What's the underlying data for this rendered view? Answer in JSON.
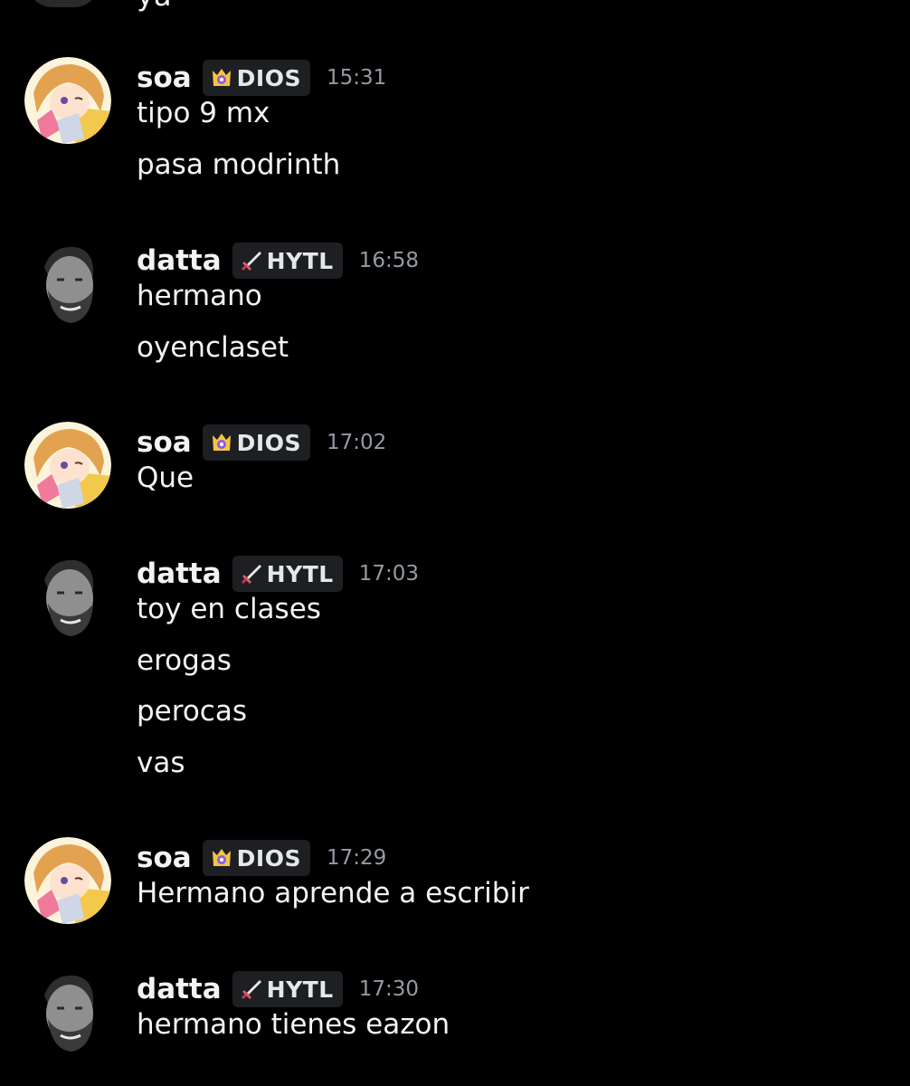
{
  "partial_message": {
    "text": "ya"
  },
  "messages": [
    {
      "author": "soa",
      "avatar": "anime-girl-avatar",
      "tag": {
        "icon": "crown-badge-icon",
        "label": "DIOS"
      },
      "time": "15:31",
      "lines": [
        "tipo 9 mx",
        "pasa modrinth"
      ]
    },
    {
      "author": "datta",
      "avatar": "bearded-man-avatar",
      "tag": {
        "icon": "sword-icon",
        "label": "HYTL"
      },
      "time": "16:58",
      "lines": [
        "hermano",
        "oyenclaset"
      ]
    },
    {
      "author": "soa",
      "avatar": "anime-girl-avatar",
      "tag": {
        "icon": "crown-badge-icon",
        "label": "DIOS"
      },
      "time": "17:02",
      "lines": [
        "Que"
      ]
    },
    {
      "author": "datta",
      "avatar": "bearded-man-avatar",
      "tag": {
        "icon": "sword-icon",
        "label": "HYTL"
      },
      "time": "17:03",
      "lines": [
        "toy en clases",
        "erogas",
        "perocas",
        "vas"
      ]
    },
    {
      "author": "soa",
      "avatar": "anime-girl-avatar",
      "tag": {
        "icon": "crown-badge-icon",
        "label": "DIOS"
      },
      "time": "17:29",
      "lines": [
        "Hermano aprende a escribir"
      ]
    },
    {
      "author": "datta",
      "avatar": "bearded-man-avatar",
      "tag": {
        "icon": "sword-icon",
        "label": "HYTL"
      },
      "time": "17:30",
      "lines": [
        "hermano tienes eazon"
      ]
    }
  ],
  "colors": {
    "background": "#000000",
    "text": "#f2f3f5",
    "timestamp": "#949ba4",
    "tag_background": "#1e1f22"
  }
}
